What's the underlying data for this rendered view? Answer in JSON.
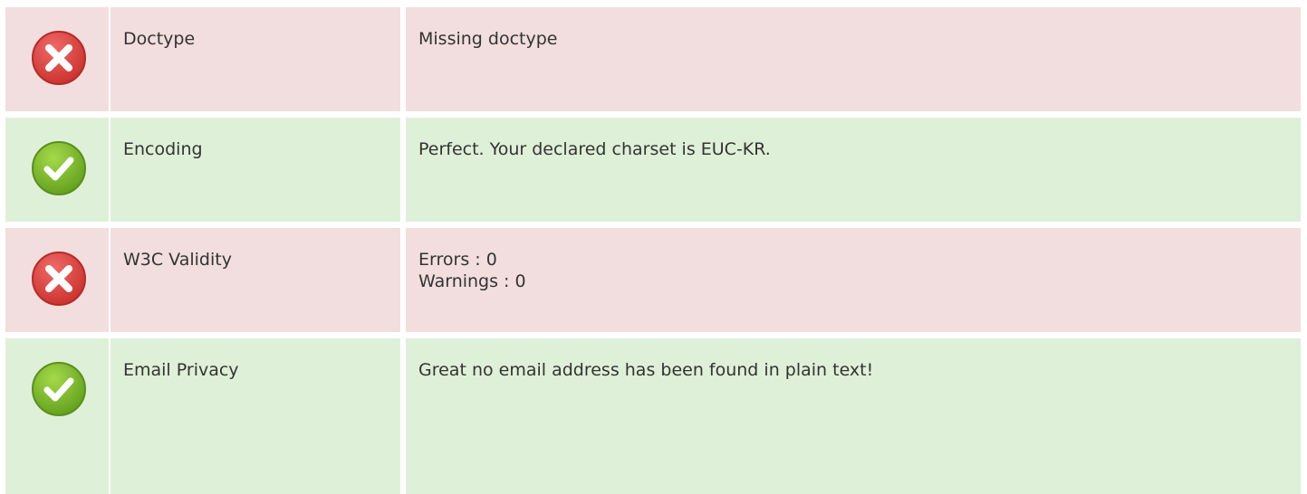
{
  "colors": {
    "fail_bg": "#f2dedf",
    "pass_bg": "#dff0d8",
    "fail_icon": "#d9403f",
    "pass_icon": "#7dbb2a"
  },
  "rows": [
    {
      "status": "fail",
      "icon": "error-x-icon",
      "label": "Doctype",
      "lines": [
        "Missing doctype"
      ]
    },
    {
      "status": "pass",
      "icon": "success-check-icon",
      "label": "Encoding",
      "lines": [
        "Perfect. Your declared charset is EUC-KR."
      ]
    },
    {
      "status": "fail",
      "icon": "error-x-icon",
      "label": "W3C Validity",
      "lines": [
        "Errors : 0",
        "Warnings : 0"
      ]
    },
    {
      "status": "pass",
      "icon": "success-check-icon",
      "label": "Email Privacy",
      "lines": [
        "Great no email address has been found in plain text!"
      ]
    }
  ]
}
